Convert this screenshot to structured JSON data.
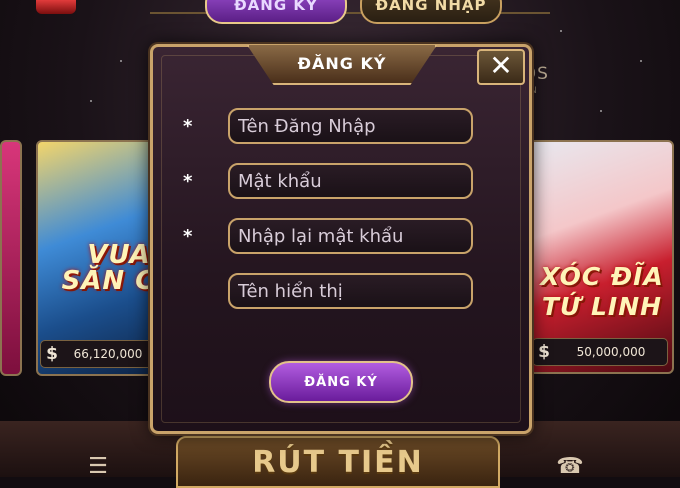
{
  "nav": {
    "register_tab": "ĐĂNG KÝ",
    "login_tab": "ĐĂNG NHẬP"
  },
  "games": {
    "left": {
      "title_line1": "VUA",
      "title_line2": "SĂN CÁ",
      "jackpot": "66,120,000"
    },
    "right": {
      "title_line1": "XÓC ĐĨA",
      "title_line2": "TỨ LINH",
      "jackpot": "50,000,000"
    }
  },
  "background_brand": {
    "line1": "DS",
    "line2": "ON"
  },
  "bottom": {
    "withdraw_label": "RÚT TIỀN"
  },
  "modal": {
    "title": "ĐĂNG KÝ",
    "close": "✕",
    "fields": [
      {
        "placeholder": "Tên Đăng Nhập",
        "required_mark": "*"
      },
      {
        "placeholder": "Mật khẩu",
        "required_mark": "*"
      },
      {
        "placeholder": "Nhập lại mật khẩu",
        "required_mark": "*"
      },
      {
        "placeholder": "Tên hiển thị",
        "required_mark": ""
      }
    ],
    "submit_label": "ĐĂNG KÝ"
  },
  "currency_symbol": "$",
  "colors": {
    "accent_gold": "#c9a36a",
    "button_purple": "#8a3bc0"
  }
}
